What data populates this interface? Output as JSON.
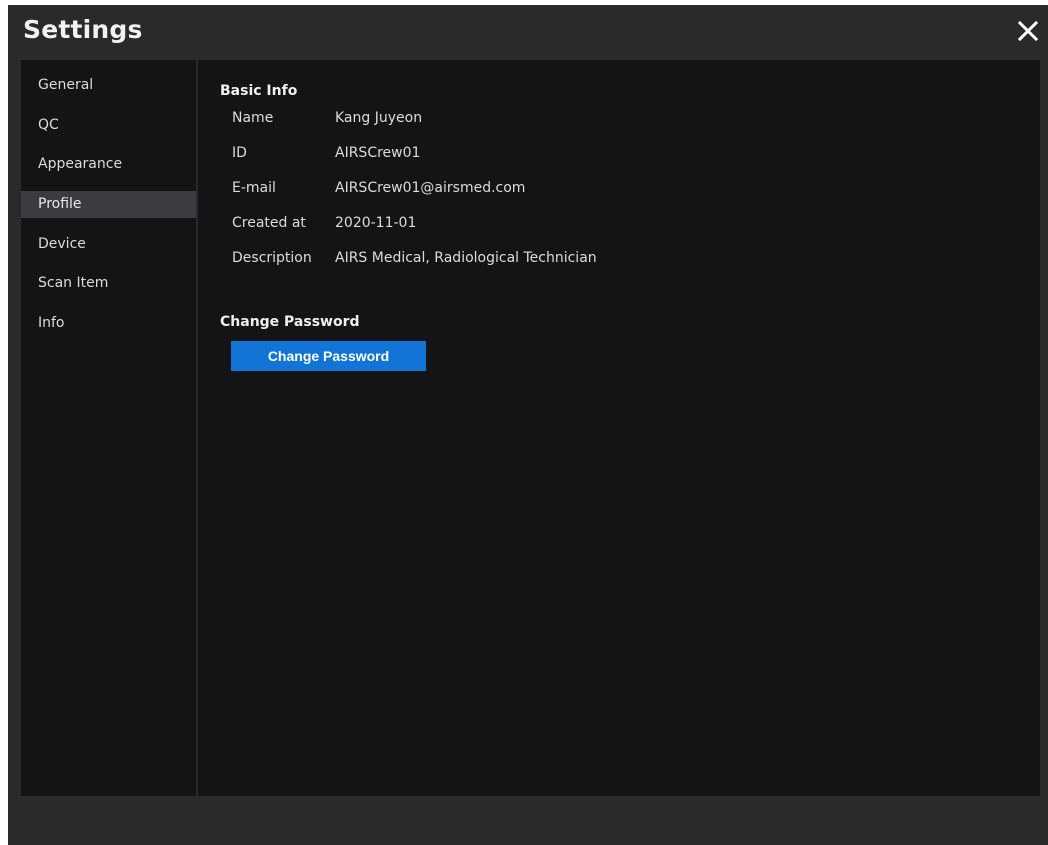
{
  "window": {
    "title": "Settings"
  },
  "sidebar": {
    "items": [
      {
        "label": "General"
      },
      {
        "label": "QC"
      },
      {
        "label": "Appearance"
      },
      {
        "label": "Profile",
        "active": true
      },
      {
        "label": "Device"
      },
      {
        "label": "Scan Item"
      },
      {
        "label": "Info"
      }
    ]
  },
  "profile": {
    "basic_info": {
      "title": "Basic Info",
      "rows": [
        {
          "label": "Name",
          "value": "Kang Juyeon"
        },
        {
          "label": "ID",
          "value": "AIRSCrew01"
        },
        {
          "label": "E-mail",
          "value": "AIRSCrew01@airsmed.com"
        },
        {
          "label": "Created at",
          "value": "2020-11-01"
        },
        {
          "label": "Description",
          "value": "AIRS Medical, Radiological Technician"
        }
      ]
    },
    "change_password": {
      "title": "Change Password",
      "button_label": "Change Password"
    }
  },
  "colors": {
    "dialog_bg": "#2a2a2c",
    "panel_bg": "#141416",
    "active_item_bg": "#3c3c40",
    "accent_button": "#1274d6"
  },
  "icons": {
    "close": "close-icon"
  }
}
